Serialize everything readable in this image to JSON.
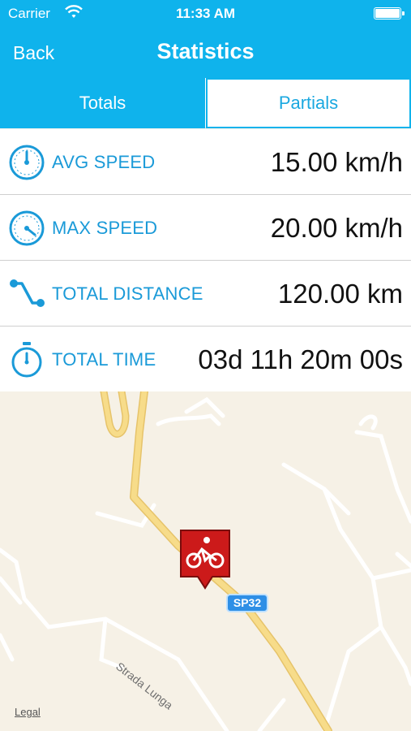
{
  "status_bar": {
    "carrier": "Carrier",
    "time": "11:33 AM"
  },
  "nav": {
    "back_label": "Back",
    "title": "Statistics"
  },
  "tabs": {
    "totals": "Totals",
    "partials": "Partials",
    "selected": "Totals"
  },
  "stats": [
    {
      "label": "AVG SPEED",
      "value": "15.00 km/h",
      "icon": "speedometer-icon"
    },
    {
      "label": "MAX SPEED",
      "value": "20.00 km/h",
      "icon": "speedometer-icon"
    },
    {
      "label": "TOTAL DISTANCE",
      "value": "120.00 km",
      "icon": "route-icon"
    },
    {
      "label": "TOTAL TIME",
      "value": "03d 11h 20m 00s",
      "icon": "stopwatch-icon"
    }
  ],
  "map": {
    "road_badge": "SP32",
    "street_name": "Strada Lunga",
    "legal_link": "Legal",
    "marker_icon": "bicycle-icon"
  },
  "colors": {
    "accent": "#0fb3ec",
    "label_blue": "#1a9ad8",
    "marker_red": "#cc1a1a",
    "main_road": "#f2cc6b"
  }
}
